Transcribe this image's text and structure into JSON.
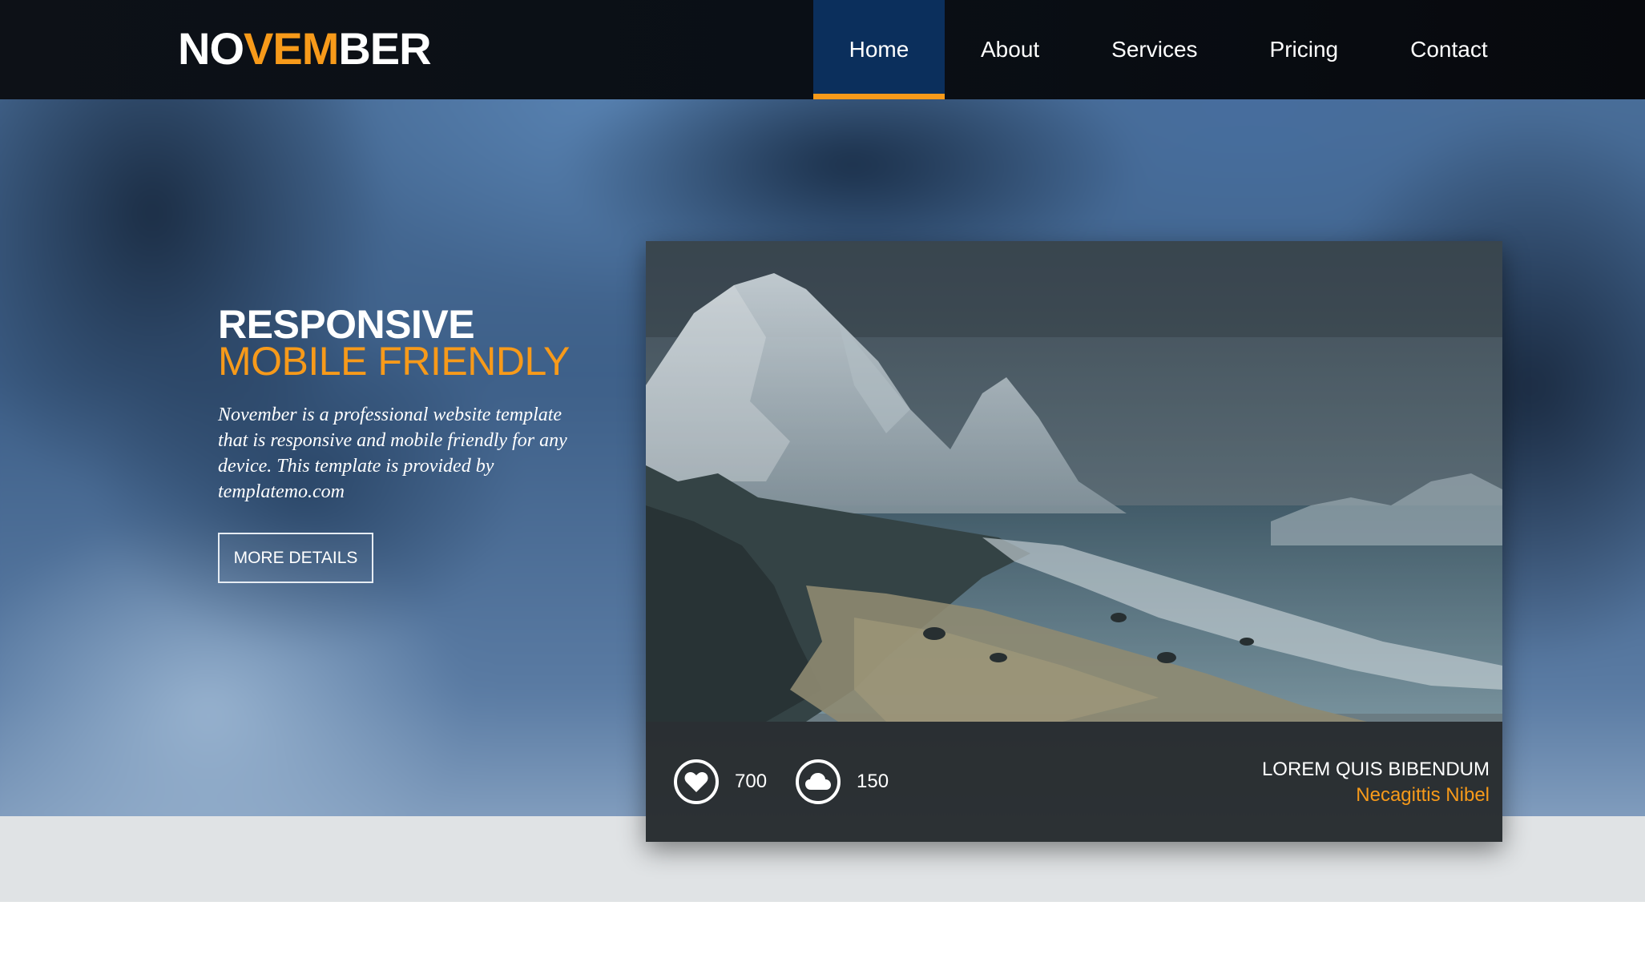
{
  "brand": {
    "logo_part1": "NO",
    "logo_part2": "VEM",
    "logo_part3": "BER",
    "accent_color": "#f79a1a",
    "nav_active_color": "#0b2f5c"
  },
  "nav": {
    "items": [
      {
        "label": "Home",
        "active": true
      },
      {
        "label": "About",
        "active": false
      },
      {
        "label": "Services",
        "active": false
      },
      {
        "label": "Pricing",
        "active": false
      },
      {
        "label": "Contact",
        "active": false
      }
    ]
  },
  "hero": {
    "headline_line1": "RESPONSIVE",
    "headline_line2": "MOBILE FRIENDLY",
    "description": "November is a professional website template that is responsive and mobile friendly for any device. This template is provided by templatemo.com",
    "cta_label": "MORE DETAILS"
  },
  "card": {
    "likes_count": "700",
    "likes_icon": "heart-icon",
    "cloud_count": "150",
    "cloud_icon": "cloud-icon",
    "caption_title": "LOREM QUIS BIBENDUM",
    "caption_subtitle": "Necagittis Nibel"
  }
}
